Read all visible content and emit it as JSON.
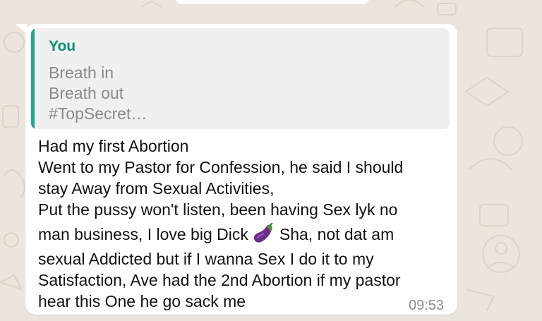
{
  "quote": {
    "author": "You",
    "lines": [
      "Breath in",
      "Breath out",
      "#TopSecret…"
    ]
  },
  "message": {
    "lines": [
      "Had my first Abortion",
      "Went to my Pastor for Confession, he said I should",
      "stay Away from Sexual Activities,",
      "Put the pussy won't listen, been having Sex lyk no",
      "man business, I love big Dick",
      "Sha, not dat am",
      "sexual Addicted but if I wanna Sex I do it to my",
      "Satisfaction, Ave had the 2nd Abortion if my pastor",
      "hear this One he go sack me"
    ],
    "emoji": "eggplant",
    "time": "09:53"
  },
  "colors": {
    "wallpaper": "#ece5dd",
    "bubble": "#ffffff",
    "quote_bar": "#1fa98a",
    "quote_author": "#0b8f72"
  }
}
